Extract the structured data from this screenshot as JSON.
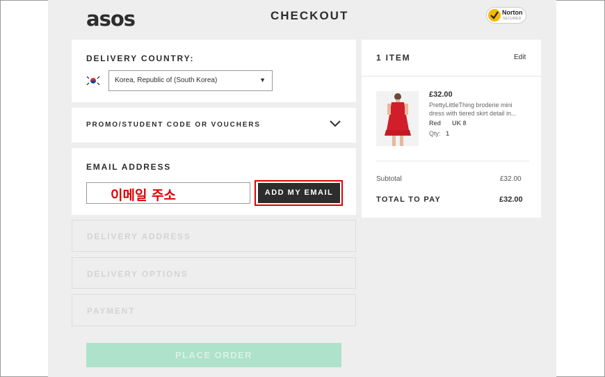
{
  "header": {
    "logo": "asos",
    "title": "CHECKOUT",
    "norton_title": "Norton",
    "norton_sub": "SECURED"
  },
  "delivery_country": {
    "label": "DELIVERY COUNTRY:",
    "selected": "Korea, Republic of (South Korea)"
  },
  "promo": {
    "label": "PROMO/STUDENT CODE OR VOUCHERS"
  },
  "email": {
    "label": "EMAIL ADDRESS",
    "value": "이메일 주소",
    "button": "ADD MY EMAIL"
  },
  "steps": {
    "delivery_address": "DELIVERY ADDRESS",
    "delivery_options": "DELIVERY OPTIONS",
    "payment": "PAYMENT",
    "place_order": "PLACE ORDER"
  },
  "summary": {
    "items_label": "1 ITEM",
    "edit": "Edit",
    "item": {
      "price": "£32.00",
      "name": "PrettyLittleThing broderie mini dress with tiered skirt detail in...",
      "color": "Red",
      "size": "UK 8",
      "qty_label": "Qty:",
      "qty": "1"
    },
    "subtotal_label": "Subtotal",
    "subtotal": "£32.00",
    "total_label": "TOTAL TO PAY",
    "total": "£32.00"
  },
  "colors": {
    "accent_red": "#e00000",
    "dark": "#2d2d2d",
    "place_order_green": "#aee2cb"
  }
}
